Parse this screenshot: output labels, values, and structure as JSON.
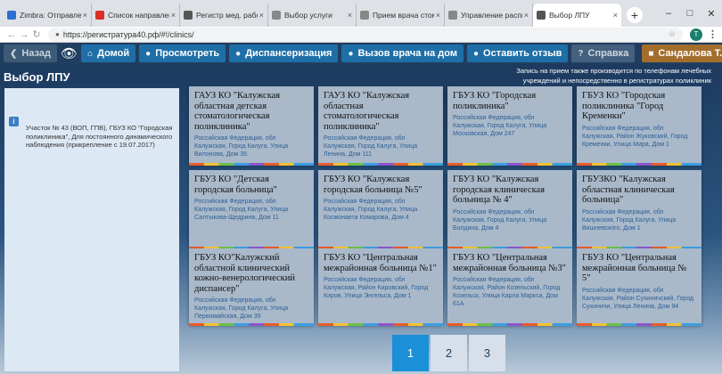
{
  "browser": {
    "tabs": [
      {
        "label": "Zimbra: Отправлено",
        "icon": "zimbra-icon",
        "color": "#2b6fd1"
      },
      {
        "label": "Список направлений - ",
        "icon": "list-icon",
        "color": "#d93025"
      },
      {
        "label": "Регистр мед. работников",
        "icon": "gear-icon",
        "color": "#555555"
      },
      {
        "label": "Выбор услуги",
        "icon": "doc-icon",
        "color": "#888888"
      },
      {
        "label": "Прием врача стоматол",
        "icon": "doc-icon",
        "color": "#888888"
      },
      {
        "label": "Управление расписанием",
        "icon": "doc-icon",
        "color": "#888888"
      },
      {
        "label": "Выбор ЛПУ",
        "icon": "gear-icon",
        "color": "#555555"
      }
    ],
    "url": "https://регистратура40.рф/#!/clinics/",
    "account_initial": "T"
  },
  "nav": {
    "back": "Назад",
    "home": "Домой",
    "view": "Просмотреть",
    "dispensary": "Диспансеризация",
    "call_doctor": "Вызов врача на дом",
    "feedback": "Оставить отзыв",
    "help": "Справка",
    "user": "Сандалова Т.В."
  },
  "page": {
    "title": "Выбор ЛПУ",
    "notice": "Запись на прием также производится по телефонам лечебных учреждений и непосредственно в регистратурах поликлиник",
    "info": "Участок № 43 (ВОП, ГПВ), ГБУЗ КО \"Городская поликлиника\", Для постоянного динамического наблюдения (прикрепление с 19.07.2017)"
  },
  "clinics": [
    {
      "name": "ГАУЗ КО \"Калужская областная детская стоматологическая поликлиника\"",
      "address": "Российская Федерация, обл Калужская, Город Калуга, Улица Вилонова, Дом 35"
    },
    {
      "name": "ГАУЗ КО \"Калужская областная стоматологическая поликлиника\"",
      "address": "Российская Федерация, обл Калужская, Город Калуга, Улица Ленина, Дом 111"
    },
    {
      "name": "ГБУЗ КО \"Городская поликлиника\"",
      "address": "Российская Федерация, обл Калужская, Город Калуга, Улица Московская, Дом 247"
    },
    {
      "name": "ГБУЗ КО \"Городская поликлиника \"Город Кременки\"",
      "address": "Российская Федерация, обл Калужская, Район Жуковский, Город Кременки, Улица Мира, Дом 1"
    },
    {
      "name": "ГБУЗ КО \"Детская городская больница\"",
      "address": "Российская Федерация, обл Калужская, Город Калуга, Улица Салтыкова-Щедрина, Дом 11"
    },
    {
      "name": "ГБУЗ КО \"Калужская городская больница №5\"",
      "address": "Российская Федерация, обл Калужская, Город Калуга, Улица Космонавта Комарова, Дом 4"
    },
    {
      "name": "ГБУЗ КО \"Калужская городская клиническая больница № 4\"",
      "address": "Российская Федерация, обл Калужская, Город Калуга, Улица Болдина, Дом 4"
    },
    {
      "name": "ГБУЗКО \"Калужская областная клиническая больница\"",
      "address": "Российская Федерация, обл Калужская, Город Калуга, Улица Вишневского, Дом 1"
    },
    {
      "name": "ГБУЗ КО\"Калужский областной клинический кожно-венерологический диспансер\"",
      "address": "Российская Федерация, обл Калужская, Город Калуга, Улица Первомайская, Дом 35"
    },
    {
      "name": "ГБУЗ КО \"Центральная межрайонная больница №1\"",
      "address": "Российская Федерация, обл Калужская, Район Кировский, Город Киров, Улица Энгельса, Дом 1"
    },
    {
      "name": "ГБУЗ КО \"Центральная межрайонная больница №3\"",
      "address": "Российская Федерация, обл Калужская, Район Козельский, Город Козельск, Улица Карла Маркса, Дом 61А"
    },
    {
      "name": "ГБУЗ КО \"Центральная межрайонная больница № 5\"",
      "address": "Российская Федерация, обл Калужская, Район Сухиничский, Город Сухиничи, Улица Ленина, Дом 94"
    }
  ],
  "pagination": {
    "pages": [
      "1",
      "2",
      "3"
    ],
    "current": "1"
  }
}
